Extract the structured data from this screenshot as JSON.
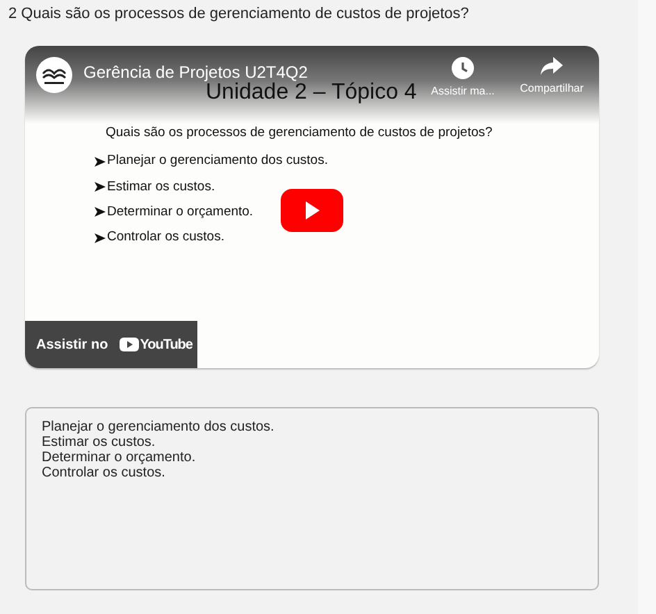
{
  "question": "2 Quais são os processos de gerenciamento de custos de projetos?",
  "video": {
    "channel_title": "Gerência de Projetos U2T4Q2",
    "actions": [
      {
        "kind": "watch_later",
        "label": "Assistir ma..."
      },
      {
        "kind": "share",
        "label": "Compartilhar"
      }
    ],
    "slide": {
      "title": "Unidade 2 – Tópico 4",
      "question": "Quais são os processos de gerenciamento de custos de projetos?",
      "bullets": [
        "Planejar o gerenciamento dos custos.",
        "Estimar os custos.",
        "Determinar o orçamento.",
        "Controlar os custos."
      ]
    },
    "watch_on": "Assistir no",
    "watch_on_brand": "YouTube"
  },
  "answer": {
    "lines": [
      "Planejar o gerenciamento dos custos.",
      "Estimar os custos.",
      "Determinar o orçamento.",
      "Controlar os custos."
    ]
  }
}
